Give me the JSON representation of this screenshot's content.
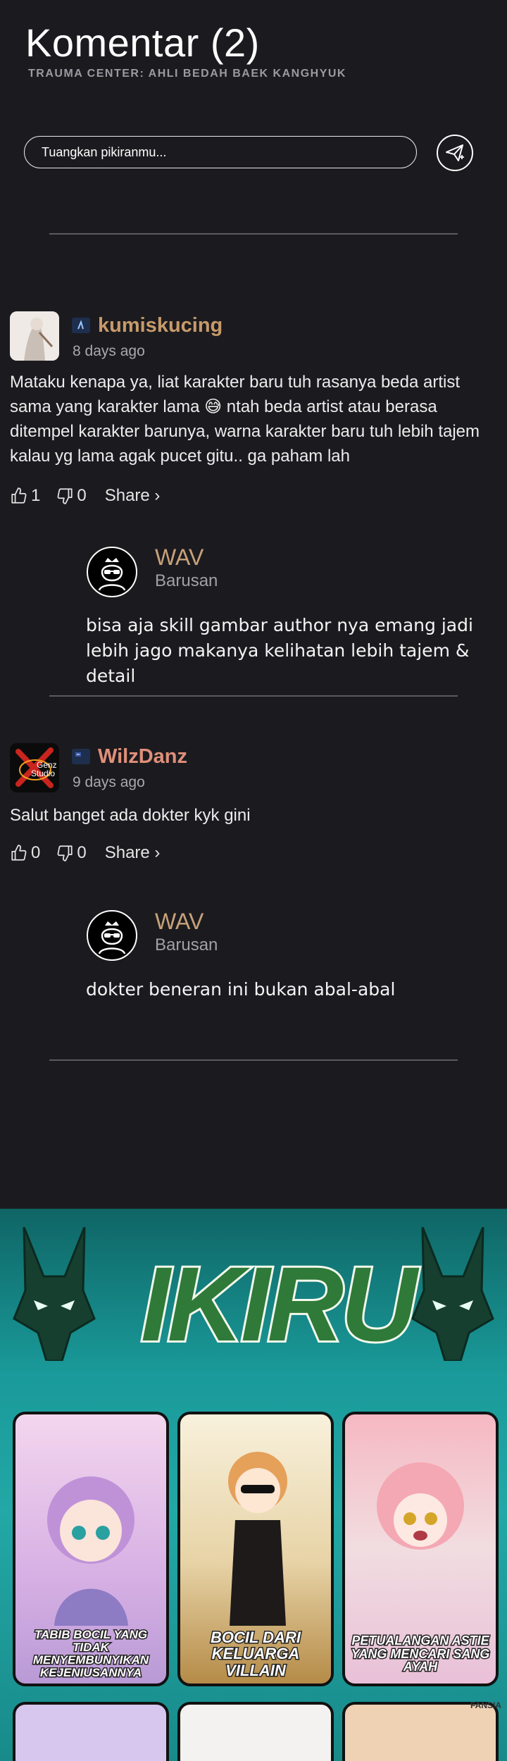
{
  "header": {
    "title": "Komentar (2)",
    "subtitle": "TRAUMA CENTER: AHLI BEDAH BAEK KANGHYUK"
  },
  "composer": {
    "placeholder": "Tuangkan pikiranmu...",
    "send_icon": "send-plane-icon"
  },
  "comments": [
    {
      "username": "kumiskucing",
      "time": "8 days ago",
      "text": "Mataku kenapa ya, liat karakter baru tuh rasanya beda artist sama yang karakter lama 😅 ntah beda artist atau berasa ditempel karakter barunya, warna karakter baru tuh lebih tajem kalau yg lama agak pucet gitu.. ga paham lah",
      "likes": "1",
      "dislikes": "0",
      "share_label": "Share ›",
      "name_color": "#c79a6a",
      "reply": {
        "username": "WAV",
        "time": "Barusan",
        "text": "bisa aja skill gambar author nya emang jadi lebih jago makanya kelihatan lebih tajem & detail"
      }
    },
    {
      "username": "WilzDanz",
      "time": "9 days ago",
      "text": "Salut banget ada dokter kyk gini",
      "likes": "0",
      "dislikes": "0",
      "share_label": "Share ›",
      "name_color": "#e0907a",
      "avatar_text": [
        "Genz",
        "Studio"
      ],
      "reply": {
        "username": "WAV",
        "time": "Barusan",
        "text": "dokter beneran ini bukan abal-abal"
      }
    }
  ],
  "banner": {
    "logo": "IKIRU",
    "cards": [
      {
        "caption": "TABIB BOCIL YANG TIDAK MENYEMBUNYIKAN KEJENIUSANNYA",
        "color": "#d9a6e0"
      },
      {
        "caption": "BOCIL DARI KELUARGA VILLAIN",
        "color": "#c9832a"
      },
      {
        "caption": "PETUALANGAN ASTIE YANG MENCARI SANG AYAH",
        "color": "#c99adf"
      }
    ],
    "watermark": "FANSIA"
  },
  "colors": {
    "background": "#1b1b1f",
    "reply_name": "#c8a27a",
    "banner": "#1a9a9a"
  }
}
